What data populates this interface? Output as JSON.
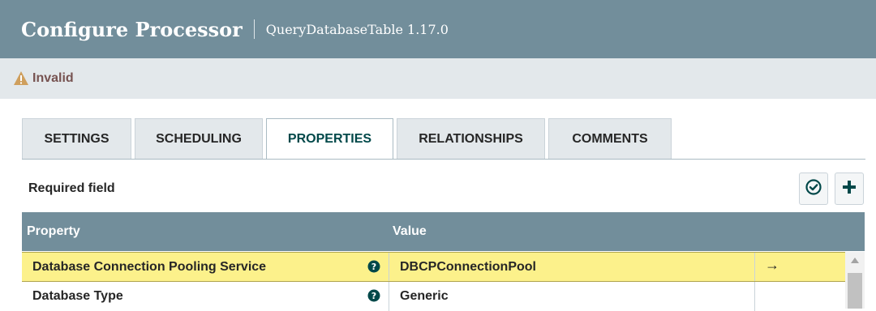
{
  "header": {
    "title": "Configure Processor",
    "subtitle": "QueryDatabaseTable 1.17.0"
  },
  "status": {
    "icon": "warning-icon",
    "text": "Invalid",
    "color": "#775351"
  },
  "tabs": [
    {
      "label": "SETTINGS",
      "active": false
    },
    {
      "label": "SCHEDULING",
      "active": false
    },
    {
      "label": "PROPERTIES",
      "active": true
    },
    {
      "label": "RELATIONSHIPS",
      "active": false
    },
    {
      "label": "COMMENTS",
      "active": false
    }
  ],
  "properties_panel": {
    "required_label": "Required field",
    "verify_icon": "check-circle-icon",
    "add_icon": "plus-icon",
    "columns": {
      "property": "Property",
      "value": "Value"
    },
    "rows": [
      {
        "name": "Database Connection Pooling Service",
        "value": "DBCPConnectionPool",
        "selected": true,
        "action": "→"
      },
      {
        "name": "Database Type",
        "value": "Generic",
        "selected": false,
        "action": ""
      }
    ]
  },
  "colors": {
    "header_bg": "#728e9b",
    "accent_dark": "#004849",
    "selected_row": "#fcf18b",
    "status_bar": "#e3e8eb"
  }
}
